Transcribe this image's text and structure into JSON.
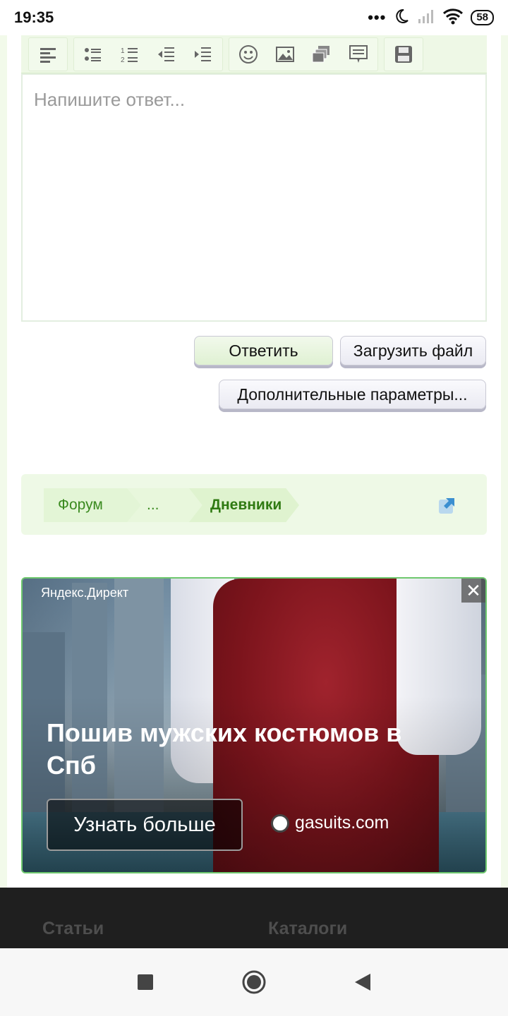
{
  "status_bar": {
    "time": "19:35",
    "battery": "58",
    "icons": [
      "more-icon",
      "moon-icon",
      "signal-icon",
      "wifi-icon",
      "battery-icon"
    ]
  },
  "editor": {
    "placeholder": "Напишите ответ...",
    "toolbar_icons": [
      "align-left-icon",
      "bulleted-list-icon",
      "numbered-list-icon",
      "outdent-icon",
      "indent-icon",
      "smiley-icon",
      "image-icon",
      "media-gallery-icon",
      "quote-icon",
      "save-icon"
    ]
  },
  "buttons": {
    "reply": "Ответить",
    "upload": "Загрузить файл",
    "extra": "Дополнительные параметры..."
  },
  "breadcrumb": {
    "items": [
      "Форум",
      "...",
      "Дневники"
    ]
  },
  "ad": {
    "source": "Яндекс.Директ",
    "close": "✕",
    "title": "Пошив мужских костюмов в Спб",
    "cta": "Узнать больше",
    "domain": "gasuits.com"
  },
  "footer": {
    "links": [
      "Статьи",
      "Каталоги"
    ]
  },
  "colors": {
    "accent_green": "#3a8a1f",
    "toolbar_bg": "#eef8e6",
    "footer_bg": "#1f1f1f"
  }
}
